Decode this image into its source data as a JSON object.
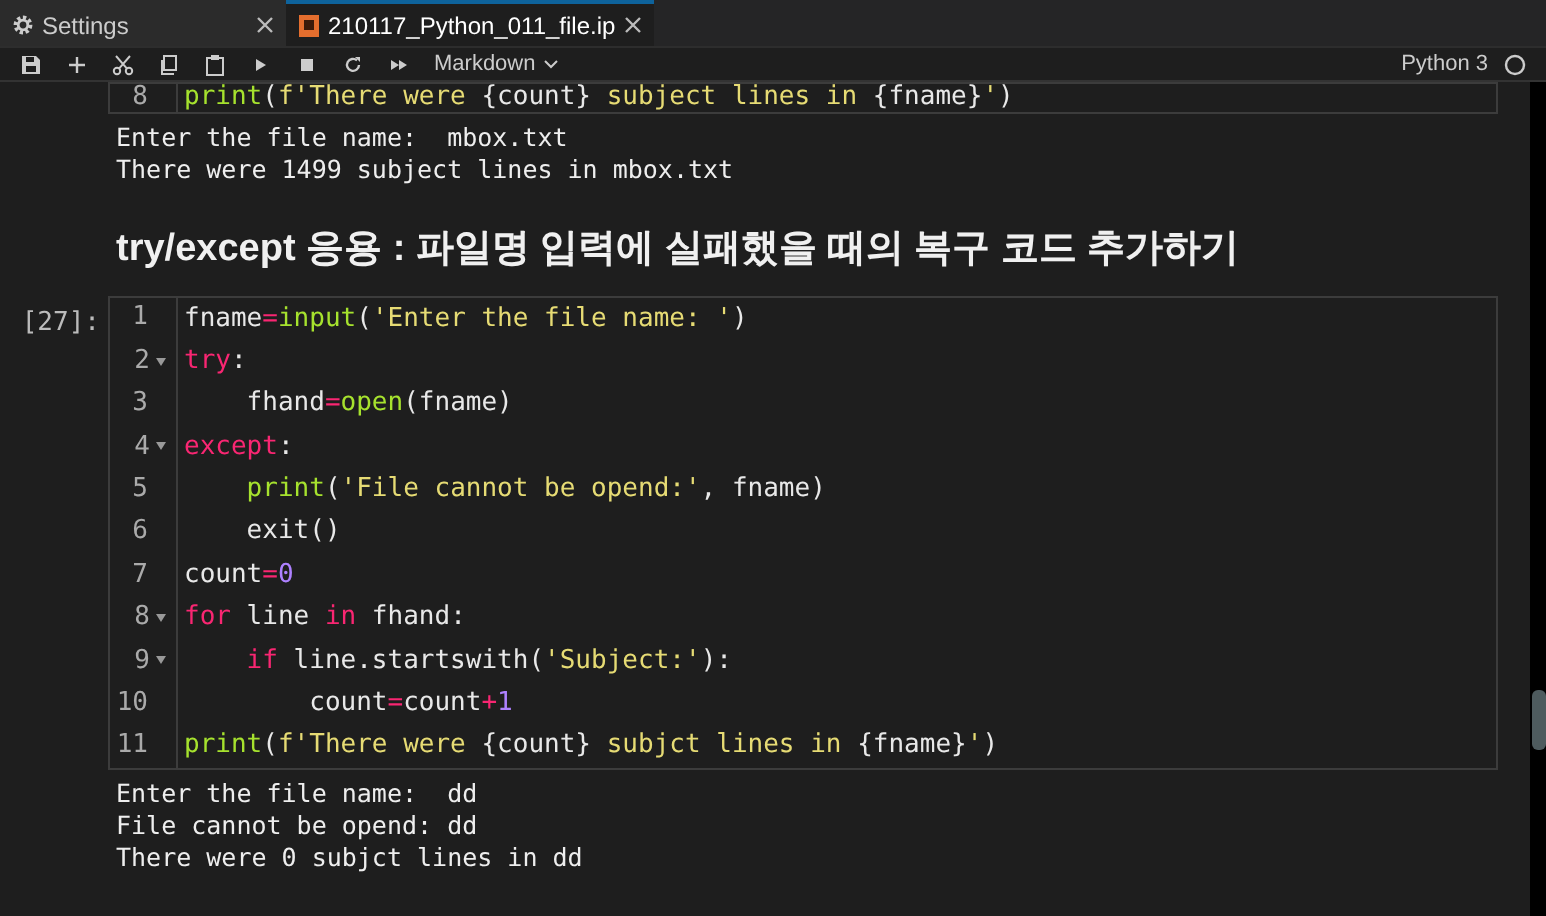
{
  "tabs": [
    {
      "label": "Settings",
      "selected": false
    },
    {
      "label": "210117_Python_011_file.ip",
      "selected": true
    }
  ],
  "toolbar": {
    "cell_type": "Markdown",
    "kernel": "Python 3",
    "kernel_busy": false
  },
  "cells": [
    {
      "kind": "code",
      "lines": [
        {
          "number": "8",
          "fold": false,
          "tokens": [
            {
              "kind": "fn",
              "text": "print"
            },
            {
              "kind": "plain",
              "text": "("
            },
            {
              "kind": "str",
              "text": "f'There were "
            },
            {
              "kind": "plain",
              "text": "{count}"
            },
            {
              "kind": "str",
              "text": " subject lines in "
            },
            {
              "kind": "plain",
              "text": "{fname}"
            },
            {
              "kind": "str",
              "text": "'"
            },
            {
              "kind": "plain",
              "text": ")"
            }
          ]
        }
      ],
      "output": [
        "Enter the file name:  mbox.txt",
        "There were 1499 subject lines in mbox.txt"
      ]
    },
    {
      "kind": "heading",
      "text": "try/except 응용 : 파일명 입력에 실패했을 때의 복구 코드 추가하기"
    },
    {
      "kind": "code",
      "prompt": "[27]:",
      "lines": [
        {
          "number": "1",
          "fold": false,
          "tokens": [
            {
              "kind": "plain",
              "text": "fname"
            },
            {
              "kind": "op",
              "text": "="
            },
            {
              "kind": "fn",
              "text": "input"
            },
            {
              "kind": "plain",
              "text": "("
            },
            {
              "kind": "str",
              "text": "'Enter the file name: '"
            },
            {
              "kind": "plain",
              "text": ")"
            }
          ]
        },
        {
          "number": "2",
          "fold": true,
          "tokens": [
            {
              "kind": "kw",
              "text": "try"
            },
            {
              "kind": "plain",
              "text": ":"
            }
          ]
        },
        {
          "number": "3",
          "fold": false,
          "tokens": [
            {
              "kind": "plain",
              "text": "    fhand"
            },
            {
              "kind": "op",
              "text": "="
            },
            {
              "kind": "fn",
              "text": "open"
            },
            {
              "kind": "plain",
              "text": "(fname)"
            }
          ]
        },
        {
          "number": "4",
          "fold": true,
          "tokens": [
            {
              "kind": "kw",
              "text": "except"
            },
            {
              "kind": "plain",
              "text": ":"
            }
          ]
        },
        {
          "number": "5",
          "fold": false,
          "tokens": [
            {
              "kind": "fn",
              "text": "    print"
            },
            {
              "kind": "plain",
              "text": "("
            },
            {
              "kind": "str",
              "text": "'File cannot be opend:'"
            },
            {
              "kind": "plain",
              "text": ", fname)"
            }
          ]
        },
        {
          "number": "6",
          "fold": false,
          "tokens": [
            {
              "kind": "plain",
              "text": "    exit()"
            }
          ]
        },
        {
          "number": "7",
          "fold": false,
          "tokens": [
            {
              "kind": "plain",
              "text": "count"
            },
            {
              "kind": "op",
              "text": "="
            },
            {
              "kind": "num",
              "text": "0"
            }
          ]
        },
        {
          "number": "8",
          "fold": true,
          "tokens": [
            {
              "kind": "kw",
              "text": "for"
            },
            {
              "kind": "plain",
              "text": " line "
            },
            {
              "kind": "kw",
              "text": "in"
            },
            {
              "kind": "plain",
              "text": " fhand:"
            }
          ]
        },
        {
          "number": "9",
          "fold": true,
          "tokens": [
            {
              "kind": "kw",
              "text": "    if"
            },
            {
              "kind": "plain",
              "text": " line.startswith("
            },
            {
              "kind": "str",
              "text": "'Subject:'"
            },
            {
              "kind": "plain",
              "text": "):"
            }
          ]
        },
        {
          "number": "10",
          "fold": false,
          "tokens": [
            {
              "kind": "plain",
              "text": "        count"
            },
            {
              "kind": "op",
              "text": "="
            },
            {
              "kind": "plain",
              "text": "count"
            },
            {
              "kind": "op",
              "text": "+"
            },
            {
              "kind": "num",
              "text": "1"
            }
          ]
        },
        {
          "number": "11",
          "fold": false,
          "tokens": [
            {
              "kind": "fn",
              "text": "print"
            },
            {
              "kind": "plain",
              "text": "("
            },
            {
              "kind": "str",
              "text": "f'There were "
            },
            {
              "kind": "plain",
              "text": "{count}"
            },
            {
              "kind": "str",
              "text": " subjct lines in "
            },
            {
              "kind": "plain",
              "text": "{fname}"
            },
            {
              "kind": "str",
              "text": "'"
            },
            {
              "kind": "plain",
              "text": ")"
            }
          ]
        }
      ],
      "output": [
        "Enter the file name:  dd",
        "File cannot be opend: dd",
        "There were 0 subjct lines in dd"
      ]
    }
  ]
}
